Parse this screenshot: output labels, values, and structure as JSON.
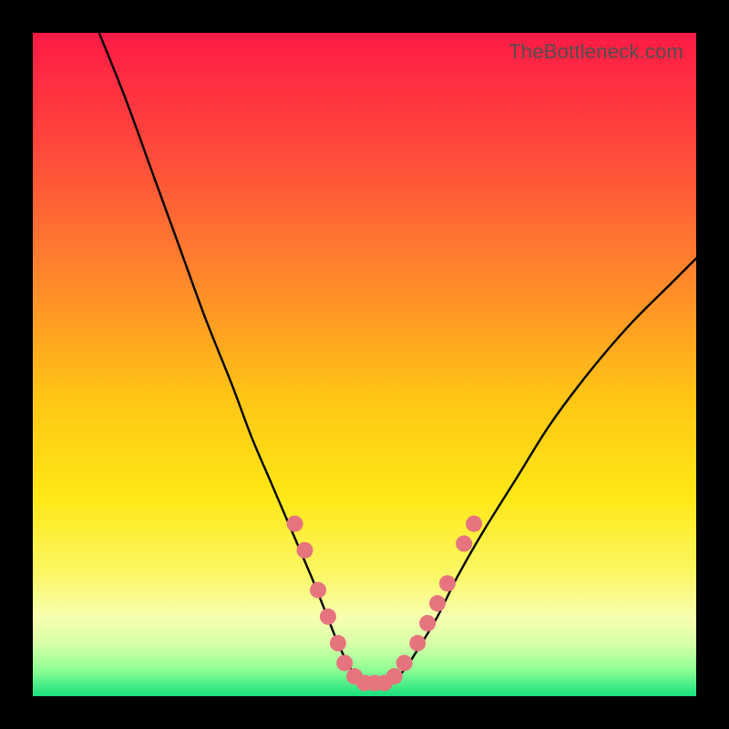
{
  "watermark": "TheBottleneck.com",
  "chart_data": {
    "type": "line",
    "title": "",
    "xlabel": "",
    "ylabel": "",
    "xlim": [
      0,
      100
    ],
    "ylim": [
      0,
      100
    ],
    "grid": false,
    "legend": false,
    "gradient_stops": [
      {
        "pct": 0,
        "color": "#ff1a45"
      },
      {
        "pct": 18,
        "color": "#ff4a3c"
      },
      {
        "pct": 38,
        "color": "#ff8a2a"
      },
      {
        "pct": 55,
        "color": "#ffc515"
      },
      {
        "pct": 70,
        "color": "#ffe815"
      },
      {
        "pct": 82,
        "color": "#fbf86a"
      },
      {
        "pct": 88,
        "color": "#f7ffb0"
      },
      {
        "pct": 92,
        "color": "#d9ffa8"
      },
      {
        "pct": 96,
        "color": "#8fff95"
      },
      {
        "pct": 100,
        "color": "#18e07e"
      }
    ],
    "series": [
      {
        "name": "bottleneck-curve",
        "color": "#000000",
        "x": [
          10,
          14,
          18,
          22,
          26,
          30,
          33,
          36,
          39,
          42,
          44,
          46,
          48,
          50,
          52,
          54,
          56,
          58,
          61,
          64,
          68,
          73,
          78,
          84,
          90,
          96,
          100
        ],
        "y": [
          100,
          90,
          79,
          68,
          57,
          47,
          39,
          32,
          25,
          18,
          13,
          8,
          4,
          2,
          2,
          2,
          4,
          7,
          12,
          18,
          25,
          33,
          41,
          49,
          56,
          62,
          66
        ]
      }
    ],
    "markers": {
      "name": "highlighted-points",
      "color": "#e6747e",
      "radius": 9,
      "points": [
        {
          "x": 39.5,
          "y": 26
        },
        {
          "x": 41.0,
          "y": 22
        },
        {
          "x": 43.0,
          "y": 16
        },
        {
          "x": 44.5,
          "y": 12
        },
        {
          "x": 46.0,
          "y": 8
        },
        {
          "x": 47.0,
          "y": 5
        },
        {
          "x": 48.5,
          "y": 3
        },
        {
          "x": 50.0,
          "y": 2
        },
        {
          "x": 51.5,
          "y": 2
        },
        {
          "x": 53.0,
          "y": 2
        },
        {
          "x": 54.5,
          "y": 3
        },
        {
          "x": 56.0,
          "y": 5
        },
        {
          "x": 58.0,
          "y": 8
        },
        {
          "x": 59.5,
          "y": 11
        },
        {
          "x": 61.0,
          "y": 14
        },
        {
          "x": 62.5,
          "y": 17
        },
        {
          "x": 65.0,
          "y": 23
        },
        {
          "x": 66.5,
          "y": 26
        }
      ]
    }
  }
}
